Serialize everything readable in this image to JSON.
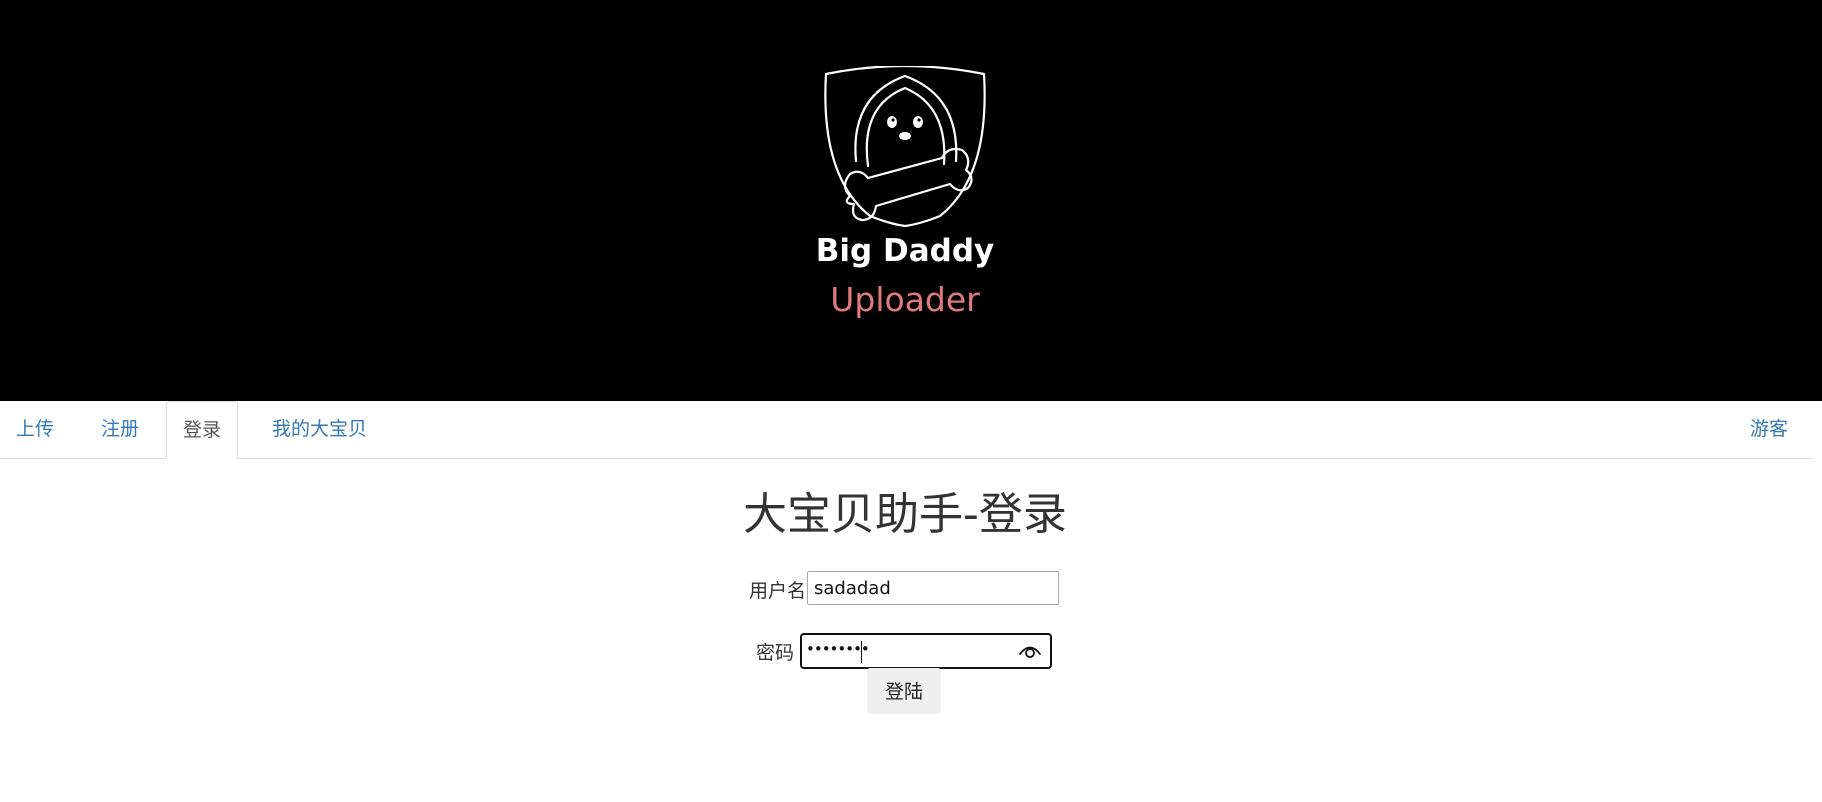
{
  "logo": {
    "title_line1": "Big Daddy",
    "title_line2": "Uploader",
    "icon": "dog-with-bone-shield-logo",
    "accent_color": "#e07b7b"
  },
  "nav": {
    "tabs": [
      {
        "label": "上传",
        "active": false
      },
      {
        "label": "注册",
        "active": false
      },
      {
        "label": "登录",
        "active": true
      },
      {
        "label": "我的大宝贝",
        "active": false
      }
    ],
    "user_label": "游客"
  },
  "main": {
    "title": "大宝贝助手-登录",
    "username_label": "用户名",
    "username_value": "sadadad",
    "password_label": "密码",
    "password_masked": "••••••••",
    "reveal_icon": "eye-icon",
    "submit_label": "登陆"
  }
}
